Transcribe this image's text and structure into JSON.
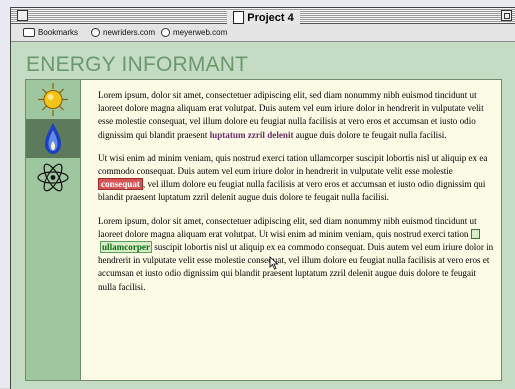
{
  "window": {
    "title": "Project 4"
  },
  "toolbar": {
    "bookmarks": "Bookmarks",
    "link1": "newriders.com",
    "link2": "meyerweb.com"
  },
  "page": {
    "title": "ENERGY INFORMANT",
    "paragraphs": [
      {
        "text1": "Lorem ipsum, dolor sit amet, consectetuer adipiscing elit, sed diam nonummy nibh euismod tincidunt ut laoreet dolore magna aliquam erat volutpat. Duis autem vel eum iriure dolor in hendrerit in vulputate velit esse molestie consequat, vel illum dolore eu feugiat nulla facilisis at vero eros et accumsan et iusto odio dignissim qui blandit praesent ",
        "link": "luptatum zzril delenit",
        "text2": " augue duis dolore te feugait nulla facilisi."
      },
      {
        "text1": "Ut wisi enim ad minim veniam, quis nostrud exerci tation ullamcorper suscipit lobortis nisl ut aliquip ex ea commodo consequat. Duis autem vel eum iriure dolor in hendrerit in vulputate velit esse molestie ",
        "highlight": "consequat",
        "text2": ", vel illum dolore eu feugiat nulla facilisis at vero eros et accumsan et iusto odio dignissim qui blandit praesent luptatum zzril delenit augue duis dolore te feugait nulla facilisi."
      },
      {
        "text1": "Lorem ipsum, dolor sit amet, consectetuer adipiscing elit, sed diam nonummy nibh euismod tincidunt ut laoreet dolore magna aliquam erat volutpat. Ut wisi enim ad minim veniam, quis nostrud exerci tation ",
        "highlight": "ullamcorper",
        "text2": " suscipit lobortis nisl ut aliquip ex ea commodo consequat. Duis autem vel eum iriure dolor in hendrerit in vulputate velit esse molestie consequat, vel illum dolore eu feugiat nulla facilisis at vero eros et accumsan et iusto odio dignissim qui blandit praesent luptatum zzril delenit augue duis dolore te feugait nulla facilisi."
      }
    ]
  },
  "icons": [
    "sun-icon",
    "flame-icon",
    "atom-icon"
  ],
  "colors": {
    "page_bg": "#c4dcc4",
    "content_bg": "#fbfbe6",
    "title": "#6c9870",
    "icon_column": "#9fc79f",
    "icon_cell_dark": "#5d7a5d",
    "link": "#6e2e6e",
    "highlight_red": "#d65454",
    "highlight_green": "#0f6b16"
  }
}
